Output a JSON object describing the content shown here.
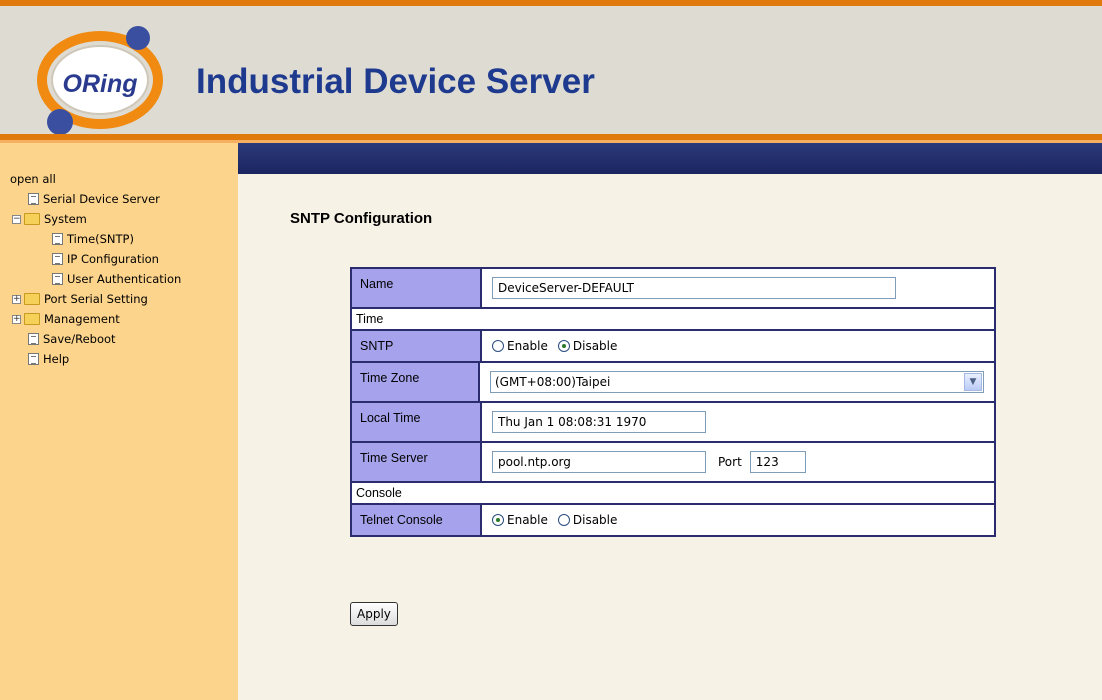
{
  "header": {
    "logo_text": "ORing",
    "title": "Industrial Device Server"
  },
  "sidebar": {
    "open_all": "open all",
    "items": [
      {
        "label": "Serial Device Server",
        "icon": "page-icon"
      },
      {
        "label": "System",
        "icon": "folder-open-icon",
        "toggle": "−"
      },
      {
        "label": "Time(SNTP)",
        "icon": "page-icon"
      },
      {
        "label": "IP Configuration",
        "icon": "page-icon"
      },
      {
        "label": "User Authentication",
        "icon": "page-icon"
      },
      {
        "label": "Port Serial Setting",
        "icon": "folder-icon",
        "toggle": "+"
      },
      {
        "label": "Management",
        "icon": "folder-icon",
        "toggle": "+"
      },
      {
        "label": "Save/Reboot",
        "icon": "page-icon"
      },
      {
        "label": "Help",
        "icon": "page-icon"
      }
    ]
  },
  "main": {
    "page_title": "SNTP Configuration",
    "name_label": "Name",
    "name_value": "DeviceServer-DEFAULT",
    "time_section": "Time",
    "sntp_label": "SNTP",
    "sntp_enable": "Enable",
    "sntp_disable": "Disable",
    "sntp_selected": "Disable",
    "timezone_label": "Time Zone",
    "timezone_value": "(GMT+08:00)Taipei",
    "localtime_label": "Local Time",
    "localtime_value": "Thu Jan 1 08:08:31 1970",
    "timeserver_label": "Time Server",
    "timeserver_value": "pool.ntp.org",
    "port_label": "Port",
    "port_value": "123",
    "console_section": "Console",
    "telnet_label": "Telnet Console",
    "telnet_enable": "Enable",
    "telnet_disable": "Disable",
    "telnet_selected": "Enable",
    "apply_label": "Apply"
  },
  "colors": {
    "accent_orange": "#e07a0c",
    "sidebar_bg": "#fdd48c",
    "label_cell": "#a6a3ec",
    "border_navy": "#2b2c6e",
    "title_blue": "#1e3a8f"
  }
}
